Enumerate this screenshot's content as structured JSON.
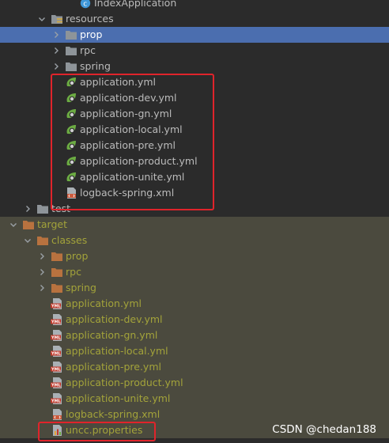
{
  "tree": {
    "index_app": "IndexApplication",
    "resources": "resources",
    "prop": "prop",
    "rpc": "rpc",
    "spring": "spring",
    "resource_files": [
      "application.yml",
      "application-dev.yml",
      "application-gn.yml",
      "application-local.yml",
      "application-pre.yml",
      "application-product.yml",
      "application-unite.yml",
      "logback-spring.xml"
    ],
    "test": "test",
    "target": "target",
    "classes": "classes",
    "class_prop": "prop",
    "class_rpc": "rpc",
    "class_spring": "spring",
    "class_files": [
      "application.yml",
      "application-dev.yml",
      "application-gn.yml",
      "application-local.yml",
      "application-pre.yml",
      "application-product.yml",
      "application-unite.yml",
      "logback-spring.xml"
    ],
    "uncc": "uncc.properties"
  },
  "watermark": "CSDN @chedan188",
  "colors": {
    "background": "#2b2b2b",
    "selection": "#4b6eaf",
    "excluded_bg": "#4b4a3e",
    "excluded_text": "#a3a33a",
    "highlight_box": "#e0242b"
  }
}
